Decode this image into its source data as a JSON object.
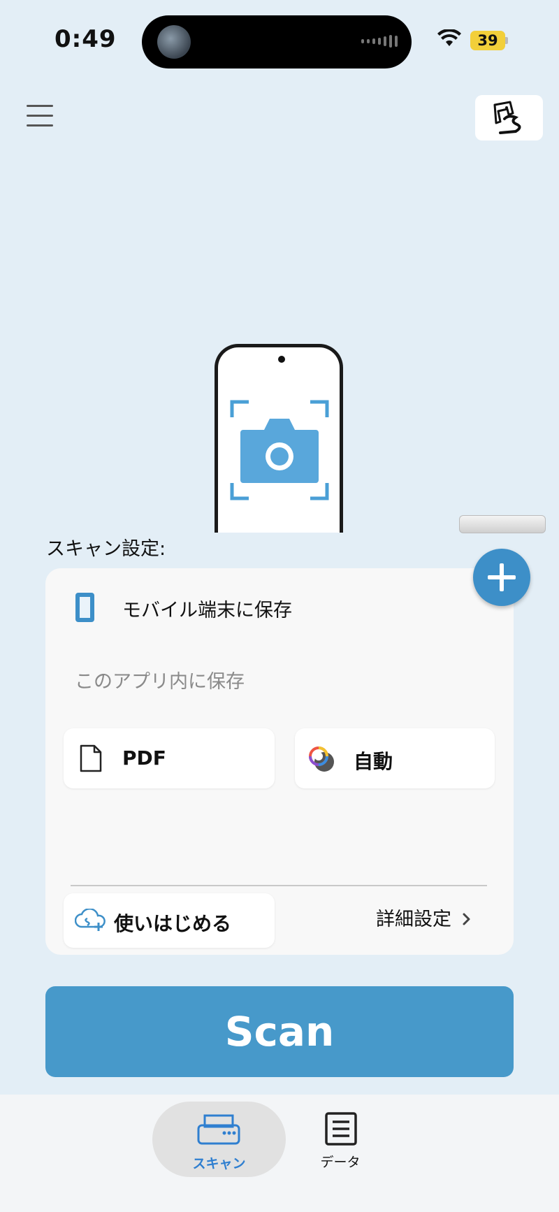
{
  "status_bar": {
    "time": "0:49",
    "battery": "39"
  },
  "icons": {
    "menu": "hamburger-icon",
    "top_right": "scanner-account-icon",
    "phone_camera": "camera-icon",
    "add": "plus-icon",
    "mobile": "mobile-device-icon",
    "pdf": "document-icon",
    "color": "color-mode-icon",
    "cloud": "cloud-plus-icon",
    "chevron": "chevron-right-icon",
    "scan_tab": "scanner-icon",
    "data_tab": "list-document-icon"
  },
  "scan_settings": {
    "title": "スキャン設定:",
    "destination": "モバイル端末に保存",
    "destination_sub": "このアプリ内に保存",
    "format": "PDF",
    "color_mode": "自動",
    "start_label": "使いはじめる",
    "advanced_label": "詳細設定"
  },
  "scan_button": "Scan",
  "tabbar": {
    "scan_label": "スキャン",
    "data_label": "データ"
  },
  "colors": {
    "accent": "#4799ca",
    "background": "#e3eef6",
    "active_tab": "#2f7fd0"
  }
}
